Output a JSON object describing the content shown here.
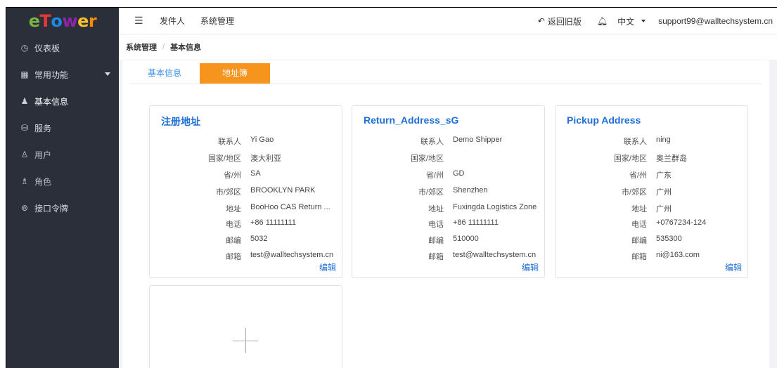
{
  "logo": {
    "letters": [
      "e",
      "T",
      "o",
      "w",
      "e",
      "r"
    ],
    "colors": [
      "#7cb342",
      "#e53935",
      "#1e88e5",
      "#8e24aa",
      "#fbc02d",
      "#fb8c00"
    ]
  },
  "sidebar": {
    "items": [
      {
        "label": "仪表板",
        "icon": "dashboard-icon",
        "glyph": "◷"
      },
      {
        "label": "常用功能",
        "icon": "grid-icon",
        "glyph": "▦"
      },
      {
        "label": "基本信息",
        "icon": "user-info-icon",
        "glyph": "♟"
      },
      {
        "label": "服务",
        "icon": "service-icon",
        "glyph": "⛁"
      },
      {
        "label": "用户",
        "icon": "user-icon",
        "glyph": "♙"
      },
      {
        "label": "角色",
        "icon": "role-icon",
        "glyph": "♗"
      },
      {
        "label": "接口令牌",
        "icon": "token-icon",
        "glyph": "⊚"
      }
    ]
  },
  "header": {
    "menu_icon": "☰",
    "nav": [
      "发件人",
      "系统管理"
    ],
    "back_label": "返回旧版",
    "back_glyph": "↶",
    "bell_glyph": "♫",
    "language": "中文",
    "user_email": "support99@walltechsystem.cn"
  },
  "breadcrumb": {
    "root": "系统管理",
    "separator": "/",
    "current": "基本信息"
  },
  "tabs": [
    "基本信息",
    "地址簿"
  ],
  "labels": {
    "contact": "联系人",
    "country": "国家/地区",
    "province": "省/州",
    "city": "市/郊区",
    "address": "地址",
    "phone": "电话",
    "postcode": "邮编",
    "email": "邮箱",
    "edit": "编辑"
  },
  "cards": [
    {
      "title": "注册地址",
      "contact": "Yi Gao",
      "country": "澳大利亚",
      "province": "SA",
      "city": "BROOKLYN PARK",
      "address": "BooHoo CAS Return ...",
      "phone": "+86 11111111",
      "postcode": "5032",
      "email": "test@walltechsystem.cn"
    },
    {
      "title": "Return_Address_sG",
      "contact": "Demo Shipper",
      "country": "",
      "province": "GD",
      "city": "Shenzhen",
      "address": "Fuxingda Logistics Zone",
      "phone": "+86 11111111",
      "postcode": "510000",
      "email": "test@walltechsystem.cn"
    },
    {
      "title": "Pickup Address",
      "contact": "ning",
      "country": "奥兰群岛",
      "province": "广东",
      "city": "广州",
      "address": "广州",
      "phone": "+0767234-124",
      "postcode": "535300",
      "email": "ni@163.com"
    }
  ]
}
